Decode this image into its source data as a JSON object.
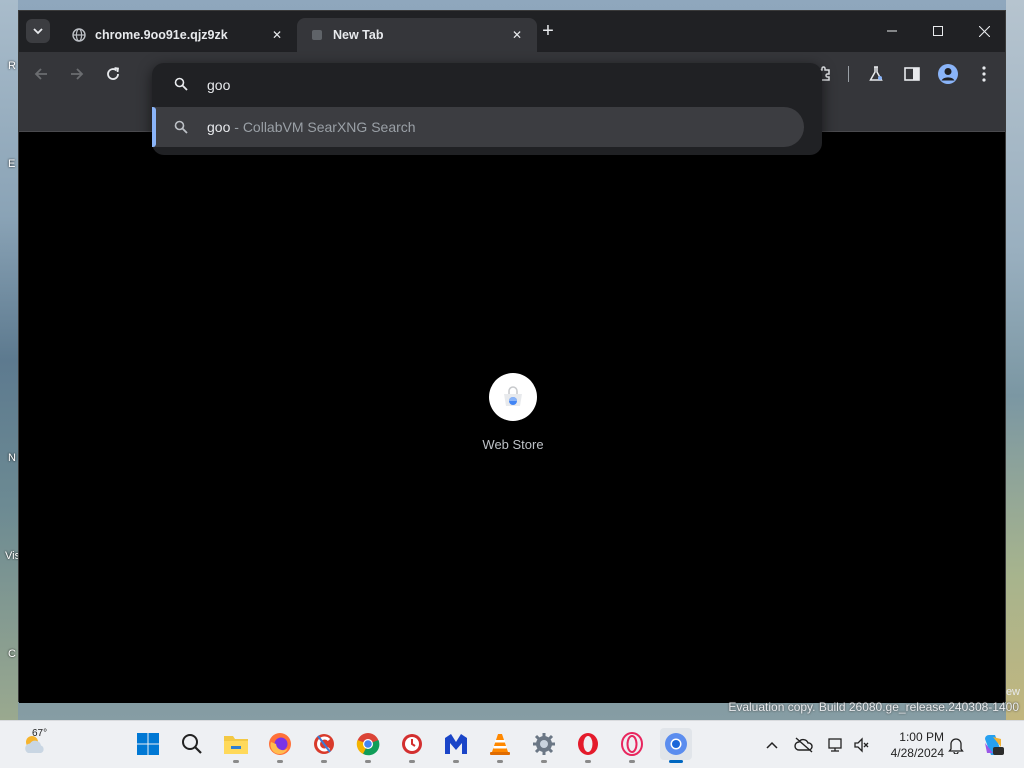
{
  "desktop": {
    "icon_labels": [
      "R",
      "E",
      "N",
      "Vis",
      "C"
    ]
  },
  "window": {
    "tabs": [
      {
        "title": "chrome.9oo91e.qjz9zk",
        "active": false
      },
      {
        "title": "New Tab",
        "active": true
      }
    ],
    "new_tab_symbol": "+",
    "controls": {
      "minimize": "minimize-icon",
      "maximize": "maximize-icon",
      "close": "close-icon"
    }
  },
  "omnibox": {
    "input_text": "goo",
    "suggestion": {
      "query": "goo",
      "separator": " - ",
      "description": "CollabVM SearXNG Search"
    }
  },
  "shortcuts": [
    {
      "label": "Web Store"
    }
  ],
  "watermark": {
    "edge_text": "ew",
    "build": "Evaluation copy. Build 26080.ge_release.240308-1400"
  },
  "taskbar": {
    "weather_temp": "67°",
    "apps": [
      "start",
      "search",
      "file-explorer",
      "firefox",
      "ccleaner",
      "chrome",
      "app-clock",
      "malwarebytes",
      "vlc",
      "settings",
      "opera",
      "opera-gx",
      "chromium"
    ],
    "clock_time": "1:00 PM",
    "clock_date": "4/28/2024"
  }
}
